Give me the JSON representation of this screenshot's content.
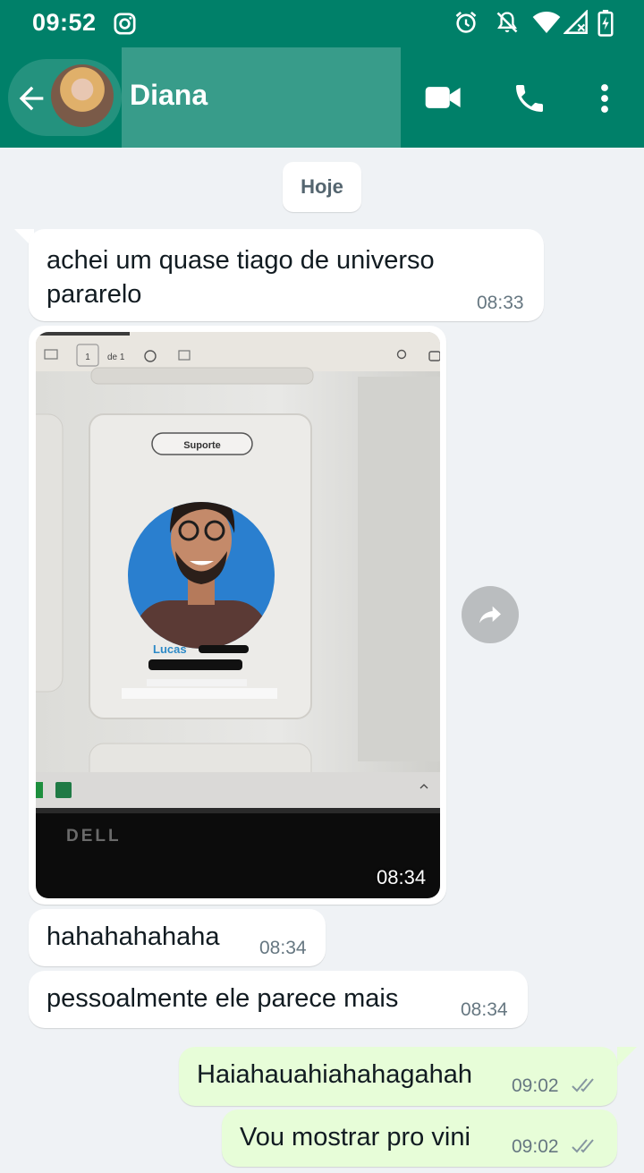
{
  "status_bar": {
    "time": "09:52",
    "icons": [
      "instagram-icon",
      "alarm-icon",
      "notifications-off-icon",
      "wifi-icon",
      "signal-icon",
      "battery-charging-icon"
    ]
  },
  "header": {
    "contact_name": "Diana",
    "actions": [
      "video-call-icon",
      "voice-call-icon",
      "more-options-icon"
    ],
    "color": "#008069"
  },
  "chat": {
    "date_chip": "Hoje",
    "messages": [
      {
        "direction": "in",
        "lines": [
          "achei um quase tiago de universo",
          "pararelo"
        ],
        "time": "08:33"
      },
      {
        "direction": "in",
        "type": "image",
        "time": "08:34",
        "image": {
          "toolbar": {
            "page_input": "1",
            "page_count": "de 1"
          },
          "card": {
            "badge": "Suporte",
            "name": "Lucas"
          },
          "brand": "DELL"
        }
      },
      {
        "direction": "in",
        "text": "hahahahahaha",
        "time": "08:34"
      },
      {
        "direction": "in",
        "text": "pessoalmente ele parece mais",
        "time": "08:34"
      },
      {
        "direction": "out",
        "text": "Haiahauahiahahagahah",
        "time": "09:02",
        "status": "delivered"
      },
      {
        "direction": "out",
        "text": "Vou mostrar pro vini",
        "time": "09:02",
        "status": "delivered"
      }
    ],
    "colors": {
      "incoming": "#ffffff",
      "outgoing": "#e7fdd8",
      "background": "#eff2f5"
    }
  }
}
